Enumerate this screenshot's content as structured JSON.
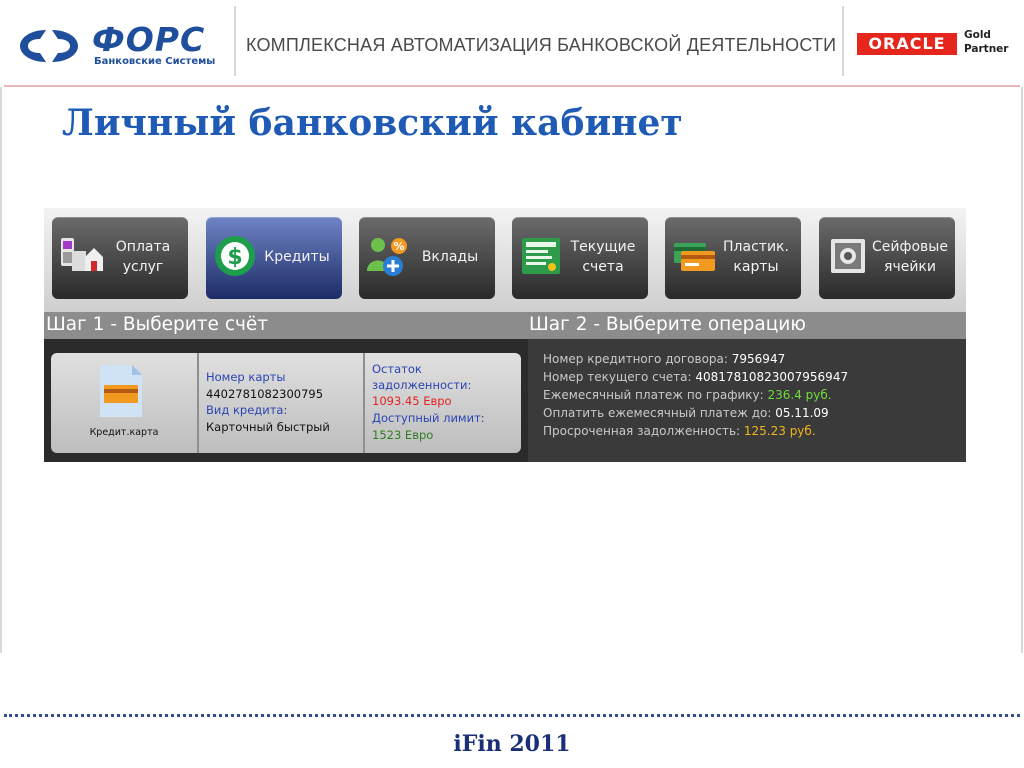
{
  "header": {
    "brand_name": "ФОРС",
    "brand_sub": "Банковские Системы",
    "tagline": "КОМПЛЕКСНАЯ АВТОМАТИЗАЦИЯ БАНКОВСКОЙ ДЕЯТЕЛЬНОСТИ",
    "oracle_logo": "ORACLE",
    "partner_level": "Gold",
    "partner_label": "Partner"
  },
  "page_title": "Личный банковский кабинет",
  "toolbar": [
    {
      "label": "Оплата\nуслуг",
      "icon": "payment-icon",
      "active": false
    },
    {
      "label": "Кредиты",
      "icon": "dollar-icon",
      "active": true
    },
    {
      "label": "Вклады",
      "icon": "deposit-icon",
      "active": false
    },
    {
      "label": "Текущие\nсчета",
      "icon": "account-icon",
      "active": false
    },
    {
      "label": "Пластик.\nкарты",
      "icon": "card-icon",
      "active": false
    },
    {
      "label": "Сейфовые\nячейки",
      "icon": "safe-icon",
      "active": false
    }
  ],
  "steps": {
    "step1": "Шаг 1 - Выберите счёт",
    "step2": "Шаг 2 - Выберите операцию"
  },
  "account_card": {
    "caption": "Кредит.карта",
    "card_number_label": "Номер карты",
    "card_number": "4402781082300795",
    "credit_type_label": "Вид кредита:",
    "credit_type": "Карточный быстрый",
    "debt_label_1": "Остаток",
    "debt_label_2": "задолженности:",
    "debt_value": "1093.45 Евро",
    "limit_label": "Доступный лимит:",
    "limit_value": "1523 Евро"
  },
  "details": {
    "contract_label": "Номер кредитного договора:",
    "contract_value": "7956947",
    "account_label": "Номер текущего счета:",
    "account_value": "40817810823007956947",
    "monthly_label": "Ежемесячный платеж по графику:",
    "monthly_value": "236.4 руб.",
    "due_label": "Оплатить ежемесячный платеж до:",
    "due_value": "05.11.09",
    "overdue_label": "Просроченная задолженность:",
    "overdue_value": "125.23 руб."
  },
  "footer": "iFin 2011",
  "colors": {
    "brand_blue": "#1f4f9c",
    "title_blue": "#1f5bb5",
    "oracle_red": "#e4261d",
    "active_tab": "#3f54a0",
    "value_green": "#6fdc3a",
    "value_yellow": "#f2b51d",
    "value_red": "#e32222"
  }
}
